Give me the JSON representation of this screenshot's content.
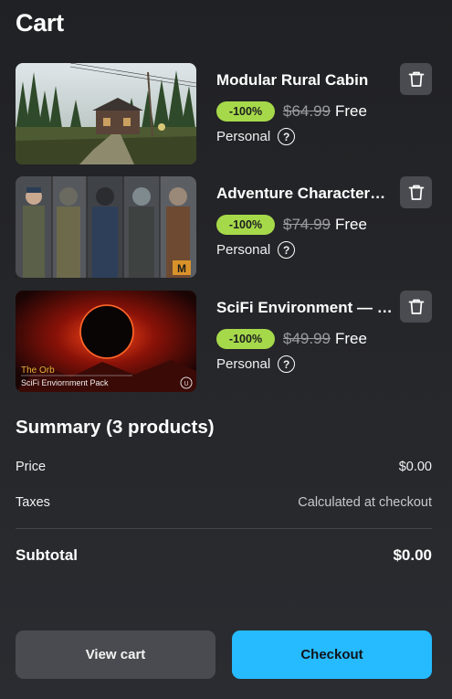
{
  "page_title": "Cart",
  "items": [
    {
      "name": "Modular Rural Cabin",
      "discount": "-100%",
      "original_price": "$64.99",
      "price": "Free",
      "license": "Personal",
      "thumbnail": "rural-cabin-scene"
    },
    {
      "name": "Adventure Character…",
      "discount": "-100%",
      "original_price": "$74.99",
      "price": "Free",
      "license": "Personal",
      "thumbnail": "character-lineup",
      "thumb_badge": "M"
    },
    {
      "name": "SciFi Environment — …",
      "discount": "-100%",
      "original_price": "$49.99",
      "price": "Free",
      "license": "Personal",
      "thumbnail": "orb-scifi-scene",
      "thumb_title": "The Orb",
      "thumb_subtitle": "SciFi Enviornment Pack",
      "thumb_badge": "U"
    }
  ],
  "summary": {
    "title": "Summary (3 products)",
    "price_label": "Price",
    "price_value": "$0.00",
    "taxes_label": "Taxes",
    "taxes_value": "Calculated at checkout",
    "subtotal_label": "Subtotal",
    "subtotal_value": "$0.00"
  },
  "buttons": {
    "view_cart": "View cart",
    "checkout": "Checkout"
  },
  "icons": {
    "delete": "trash-icon",
    "help": "question-circle-icon"
  },
  "colors": {
    "discount_badge": "#a6d94a",
    "checkout": "#26bbff",
    "secondary_button": "#4a4b50",
    "background": "#232427"
  }
}
